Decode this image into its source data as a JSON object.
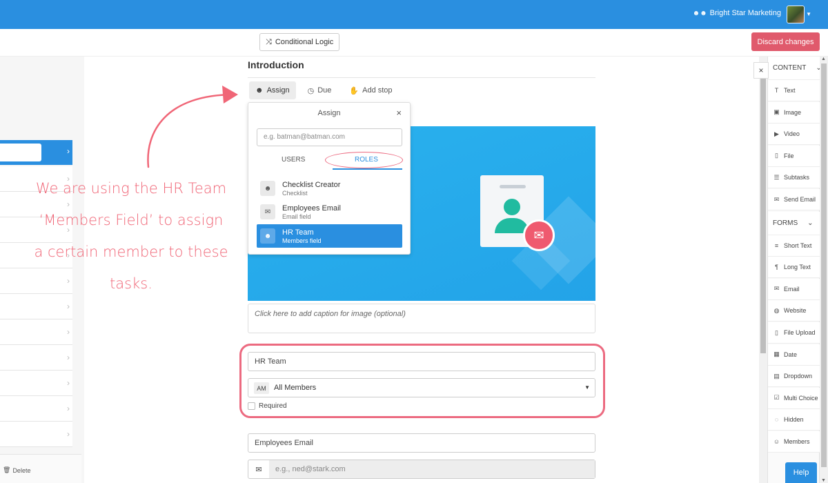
{
  "topbar": {
    "org_name": "Bright Star Marketing",
    "org_icon": "group-icon",
    "colors": {
      "bar": "#2a8fe0"
    }
  },
  "toolbar": {
    "conditional_logic": "Conditional Logic",
    "discard": "Discard changes",
    "discard_color": "#e05a6c"
  },
  "left": {
    "delete_label": "Delete"
  },
  "annotation": {
    "lines": [
      "We are using the HR Team",
      "‘Members Field’ to assign",
      "a certain member to these",
      "tasks."
    ],
    "color": "#f06677"
  },
  "editor": {
    "title": "Introduction",
    "tabs": [
      {
        "label": "Assign",
        "icon": "user-icon"
      },
      {
        "label": "Due",
        "icon": "clock-icon"
      },
      {
        "label": "Add stop",
        "icon": "hand-icon"
      }
    ],
    "caption_placeholder": "Click here to add caption for image (optional)",
    "members_field": {
      "name": "HR Team",
      "prefix": "AM",
      "selected": "All Members",
      "required_label": "Required",
      "required_checked": false
    },
    "email_field": {
      "name": "Employees Email",
      "placeholder": "e.g., ned@stark.com"
    }
  },
  "assign_popup": {
    "title": "Assign",
    "close": "×",
    "search_placeholder": "e.g. batman@batman.com",
    "tabs": {
      "users": "USERS",
      "roles": "ROLES",
      "active": "ROLES"
    },
    "roles": [
      {
        "name": "Checklist Creator",
        "sub": "Checklist",
        "icon": "user-icon"
      },
      {
        "name": "Employees Email",
        "sub": "Email field",
        "icon": "envelope-icon"
      },
      {
        "name": "HR Team",
        "sub": "Members field",
        "icon": "group-icon",
        "selected": true
      }
    ]
  },
  "right_panel": {
    "close": "×",
    "sections": [
      {
        "label": "CONTENT",
        "items": [
          {
            "label": "Text",
            "icon": "text-icon"
          },
          {
            "label": "Image",
            "icon": "image-icon"
          },
          {
            "label": "Video",
            "icon": "video-icon"
          },
          {
            "label": "File",
            "icon": "file-icon"
          },
          {
            "label": "Subtasks",
            "icon": "list-icon"
          },
          {
            "label": "Send Email",
            "icon": "email-icon"
          }
        ]
      },
      {
        "label": "FORMS",
        "items": [
          {
            "label": "Short Text",
            "icon": "short-text-icon"
          },
          {
            "label": "Long Text",
            "icon": "paragraph-icon"
          },
          {
            "label": "Email",
            "icon": "email-icon"
          },
          {
            "label": "Website",
            "icon": "globe-icon"
          },
          {
            "label": "File Upload",
            "icon": "file-icon"
          },
          {
            "label": "Date",
            "icon": "calendar-icon"
          },
          {
            "label": "Dropdown",
            "icon": "dropdown-icon"
          },
          {
            "label": "Multi Choice",
            "icon": "multi-choice-icon"
          },
          {
            "label": "Hidden",
            "icon": "hidden-icon"
          },
          {
            "label": "Members",
            "icon": "group-icon"
          }
        ]
      }
    ],
    "help": "Help"
  }
}
